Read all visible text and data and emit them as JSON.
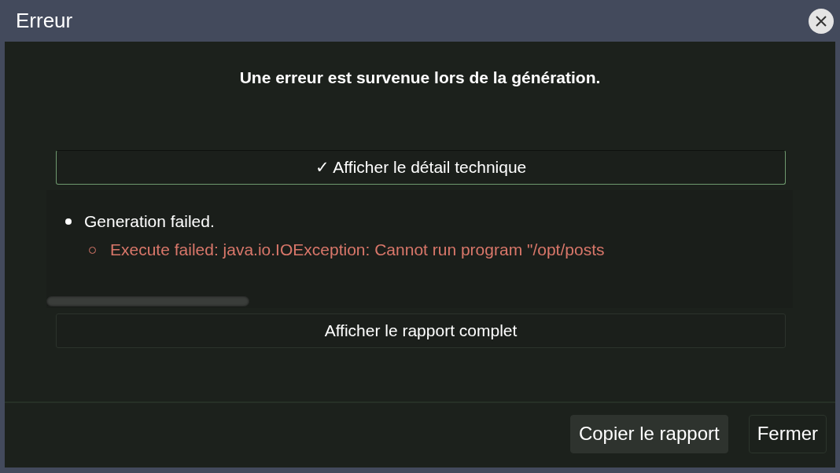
{
  "window": {
    "title": "Erreur"
  },
  "message": "Une erreur est survenue lors de la génération.",
  "details_toggle": {
    "label": "✓ Afficher le détail technique",
    "expanded": true
  },
  "details": [
    {
      "text": "Generation failed.",
      "children": [
        {
          "text": "Execute failed: java.io.IOException: Cannot run program \"/opt/posts"
        }
      ]
    }
  ],
  "report_button": "Afficher le rapport complet",
  "buttons": [
    {
      "label": "Copier le rapport",
      "kind": "primary"
    },
    {
      "label": "Fermer",
      "kind": "secondary"
    }
  ]
}
